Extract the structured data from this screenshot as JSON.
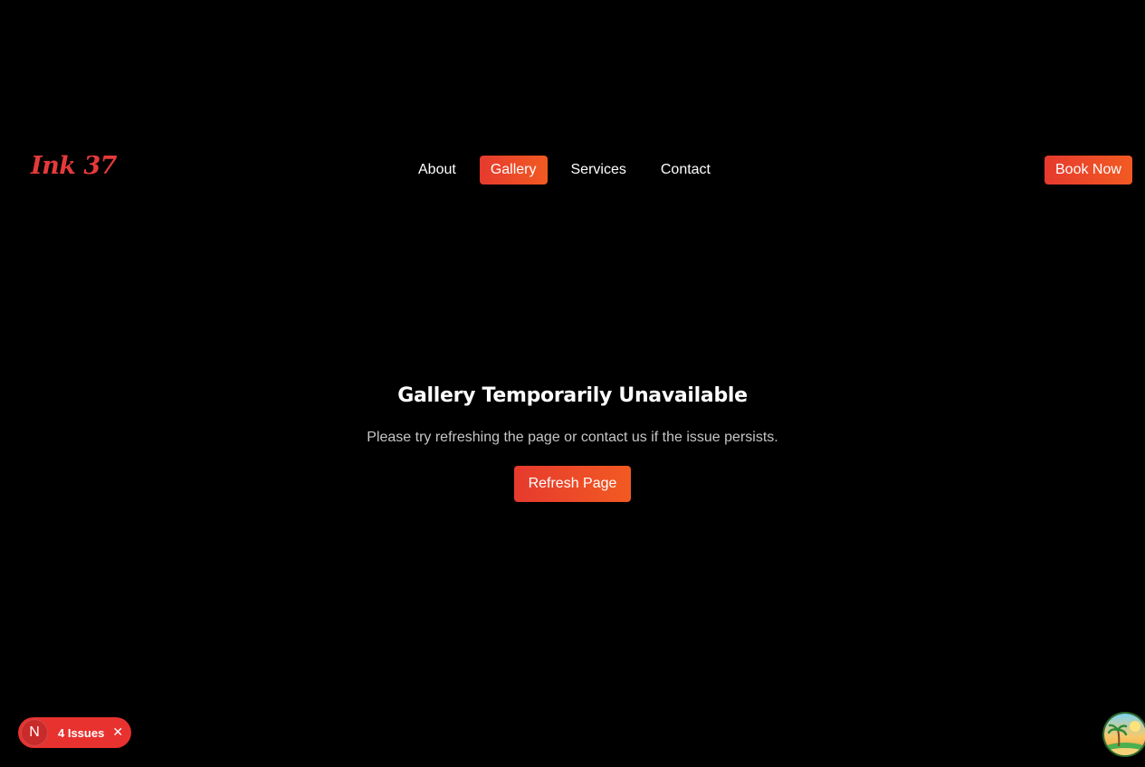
{
  "header": {
    "logo": "Ink 37",
    "nav": [
      {
        "label": "About",
        "active": false
      },
      {
        "label": "Gallery",
        "active": true
      },
      {
        "label": "Services",
        "active": false
      },
      {
        "label": "Contact",
        "active": false
      }
    ],
    "cta_label": "Book Now"
  },
  "main": {
    "title": "Gallery Temporarily Unavailable",
    "message": "Please try refreshing the page or contact us if the issue persists.",
    "refresh_label": "Refresh Page"
  },
  "dev_overlay": {
    "badge_letter": "N",
    "issues_label": "4 Issues",
    "close_icon": "close-icon"
  },
  "colors": {
    "background": "#000000",
    "accent": "#e8322f",
    "accent_gradient_end": "#f25a22",
    "muted_text": "#c6c6c6"
  }
}
